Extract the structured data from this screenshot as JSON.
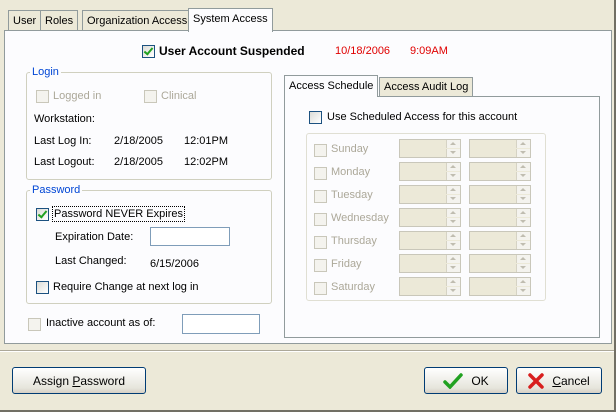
{
  "tabs": [
    "User",
    "Roles",
    "Organization Access",
    "System Access"
  ],
  "suspended": {
    "label": "User Account Suspended",
    "checked": true,
    "date": "10/18/2006",
    "time": "9:09AM"
  },
  "login": {
    "title": "Login",
    "logged_in": "Logged in",
    "clinical": "Clinical",
    "workstation_label": "Workstation:",
    "last_login_label": "Last Log In:",
    "last_login_date": "2/18/2005",
    "last_login_time": "12:01PM",
    "last_logout_label": "Last Logout:",
    "last_logout_date": "2/18/2005",
    "last_logout_time": "12:02PM"
  },
  "password": {
    "title": "Password",
    "never_expires_label": "Password NEVER Expires",
    "never_expires_checked": true,
    "expiration_label": "Expiration Date:",
    "expiration_value": "",
    "last_changed_label": "Last Changed:",
    "last_changed_value": "6/15/2006",
    "require_change_label": "Require Change at next log in"
  },
  "inactive": {
    "label": "Inactive account as of:",
    "value": ""
  },
  "schedule": {
    "tabs": [
      "Access Schedule",
      "Access Audit Log"
    ],
    "use_label": "Use Scheduled Access for this account",
    "days": [
      "Sunday",
      "Monday",
      "Tuesday",
      "Wednesday",
      "Thursday",
      "Friday",
      "Saturday"
    ]
  },
  "buttons": {
    "assign_pre": "Assign ",
    "assign_u": "P",
    "assign_post": "assword",
    "ok": "OK",
    "cancel_u": "C",
    "cancel_post": "ancel"
  },
  "colors": {
    "accent_red": "#e00000",
    "group_title": "#0046d5",
    "ok_check": "#21a121",
    "cancel_x": "#d81e1e"
  }
}
